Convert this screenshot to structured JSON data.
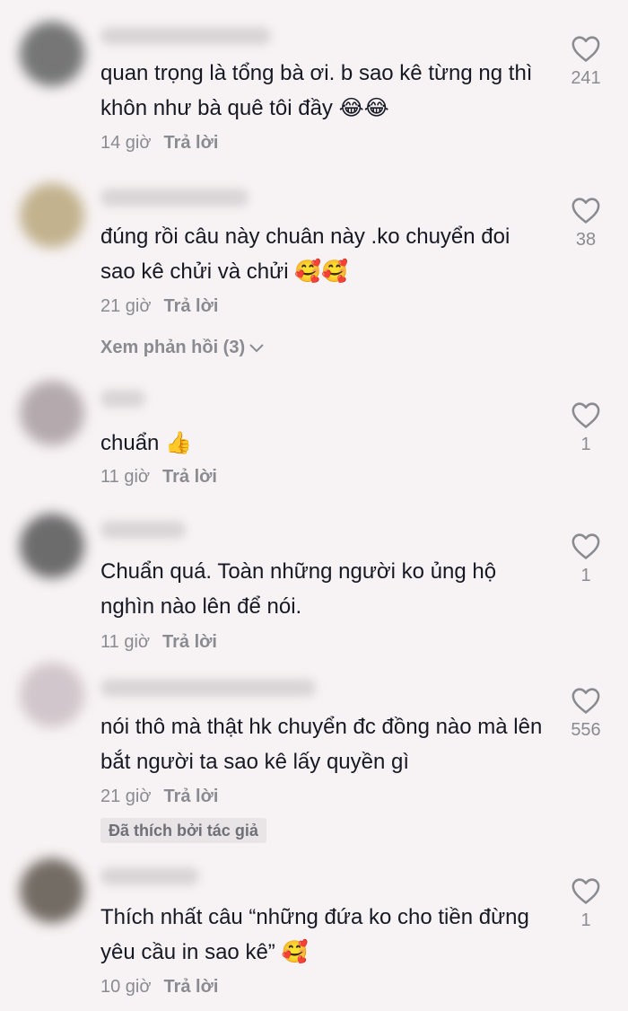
{
  "comments": [
    {
      "text": "quan trọng là tổng bà ơi. b sao kê từng ng thì khôn như bà quê tôi đầy 😂😂",
      "time": "14 giờ",
      "reply_label": "Trả lời",
      "likes": "241",
      "avatar_color": "#5f6160"
    },
    {
      "text": "đúng rồi câu này chuân này .ko chuyển đoi sao kê chửi và chửi 🥰🥰",
      "time": "21 giờ",
      "reply_label": "Trả lời",
      "likes": "38",
      "avatar_color": "#b9a77c",
      "view_replies": "Xem phản hồi (3)"
    },
    {
      "text": "chuẩn 👍",
      "time": "11 giờ",
      "reply_label": "Trả lời",
      "likes": "1",
      "avatar_color": "#a99ea2"
    },
    {
      "text": "Chuẩn quá. Toàn những người ko ủng hộ nghìn nào lên để nói.",
      "time": "11 giờ",
      "reply_label": "Trả lời",
      "likes": "1",
      "avatar_color": "#555556"
    },
    {
      "text": "nói thô mà thật hk chuyển đc đồng nào mà lên bắt người ta sao kê lấy quyền gì",
      "time": "21 giờ",
      "reply_label": "Trả lời",
      "likes": "556",
      "avatar_color": "#cbbfc4",
      "author_liked": "Đã thích bởi tác giả"
    },
    {
      "text": "Thích nhất câu “những đứa ko cho tiền đừng yêu cầu in sao kê” 🥰",
      "time": "10 giờ",
      "reply_label": "Trả lời",
      "likes": "1",
      "avatar_color": "#5d554c"
    }
  ]
}
